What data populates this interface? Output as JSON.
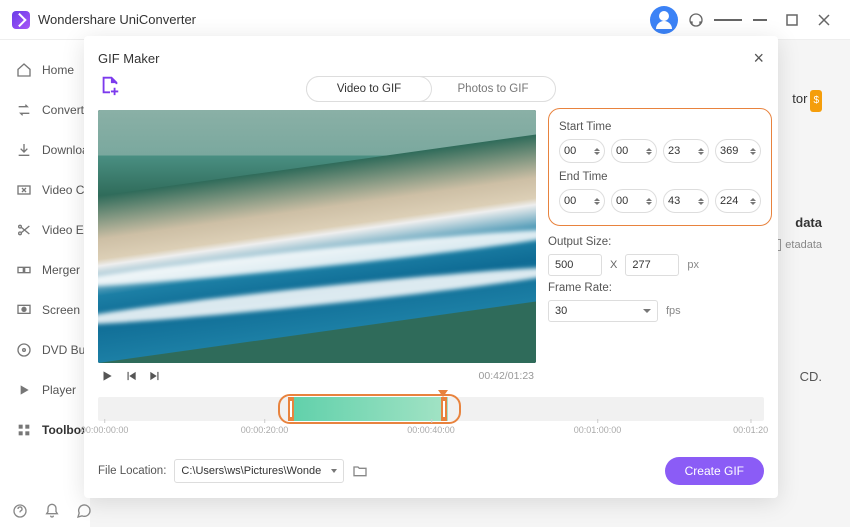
{
  "titlebar": {
    "app_name": "Wondershare UniConverter"
  },
  "sidebar": {
    "items": [
      {
        "label": "Home"
      },
      {
        "label": "Converter"
      },
      {
        "label": "Downloader"
      },
      {
        "label": "Video Compressor"
      },
      {
        "label": "Video Editor"
      },
      {
        "label": "Merger"
      },
      {
        "label": "Screen Recorder"
      },
      {
        "label": "DVD Burner"
      },
      {
        "label": "Player"
      },
      {
        "label": "Toolbox"
      }
    ]
  },
  "background": {
    "tor_label": "tor",
    "metadata_heading": "data",
    "metadata_sub": "etadata",
    "cd_label": "CD."
  },
  "modal": {
    "title": "GIF Maker",
    "tabs": {
      "video": "Video to GIF",
      "photos": "Photos to GIF"
    },
    "time_current": "00:42/01:23",
    "start_label": "Start Time",
    "start": {
      "hh": "00",
      "mm": "00",
      "ss": "23",
      "ms": "369"
    },
    "end_label": "End Time",
    "end": {
      "hh": "00",
      "mm": "00",
      "ss": "43",
      "ms": "224"
    },
    "output_label": "Output Size:",
    "output": {
      "w": "500",
      "h": "277",
      "unit": "px",
      "x": "X"
    },
    "framerate_label": "Frame Rate:",
    "framerate": {
      "value": "30",
      "unit": "fps"
    },
    "ruler": {
      "t0": "00:00:00:00",
      "t1": "00:00:20:00",
      "t2": "00:00:40:00",
      "t3": "00:01:00:00",
      "t4": "00:01:20"
    },
    "footer": {
      "location_label": "File Location:",
      "location_value": "C:\\Users\\ws\\Pictures\\Wonders",
      "create_label": "Create GIF"
    }
  }
}
